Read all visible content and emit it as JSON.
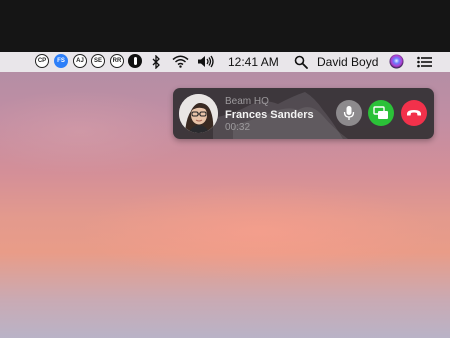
{
  "menubar": {
    "avatars": [
      {
        "initials": "CP",
        "active": false
      },
      {
        "initials": "FS",
        "active": true
      },
      {
        "initials": "AJ",
        "active": false
      },
      {
        "initials": "SE",
        "active": false
      },
      {
        "initials": "RR",
        "active": false
      }
    ],
    "clock": "12:41 AM",
    "user_name": "David Boyd"
  },
  "call": {
    "team": "Beam HQ",
    "name": "Frances Sanders",
    "duration": "00:32"
  },
  "colors": {
    "active_badge": "#2d7ff9",
    "screen_share": "#2bc138",
    "hang_up": "#f2314b",
    "mute": "#8d8a8d"
  }
}
